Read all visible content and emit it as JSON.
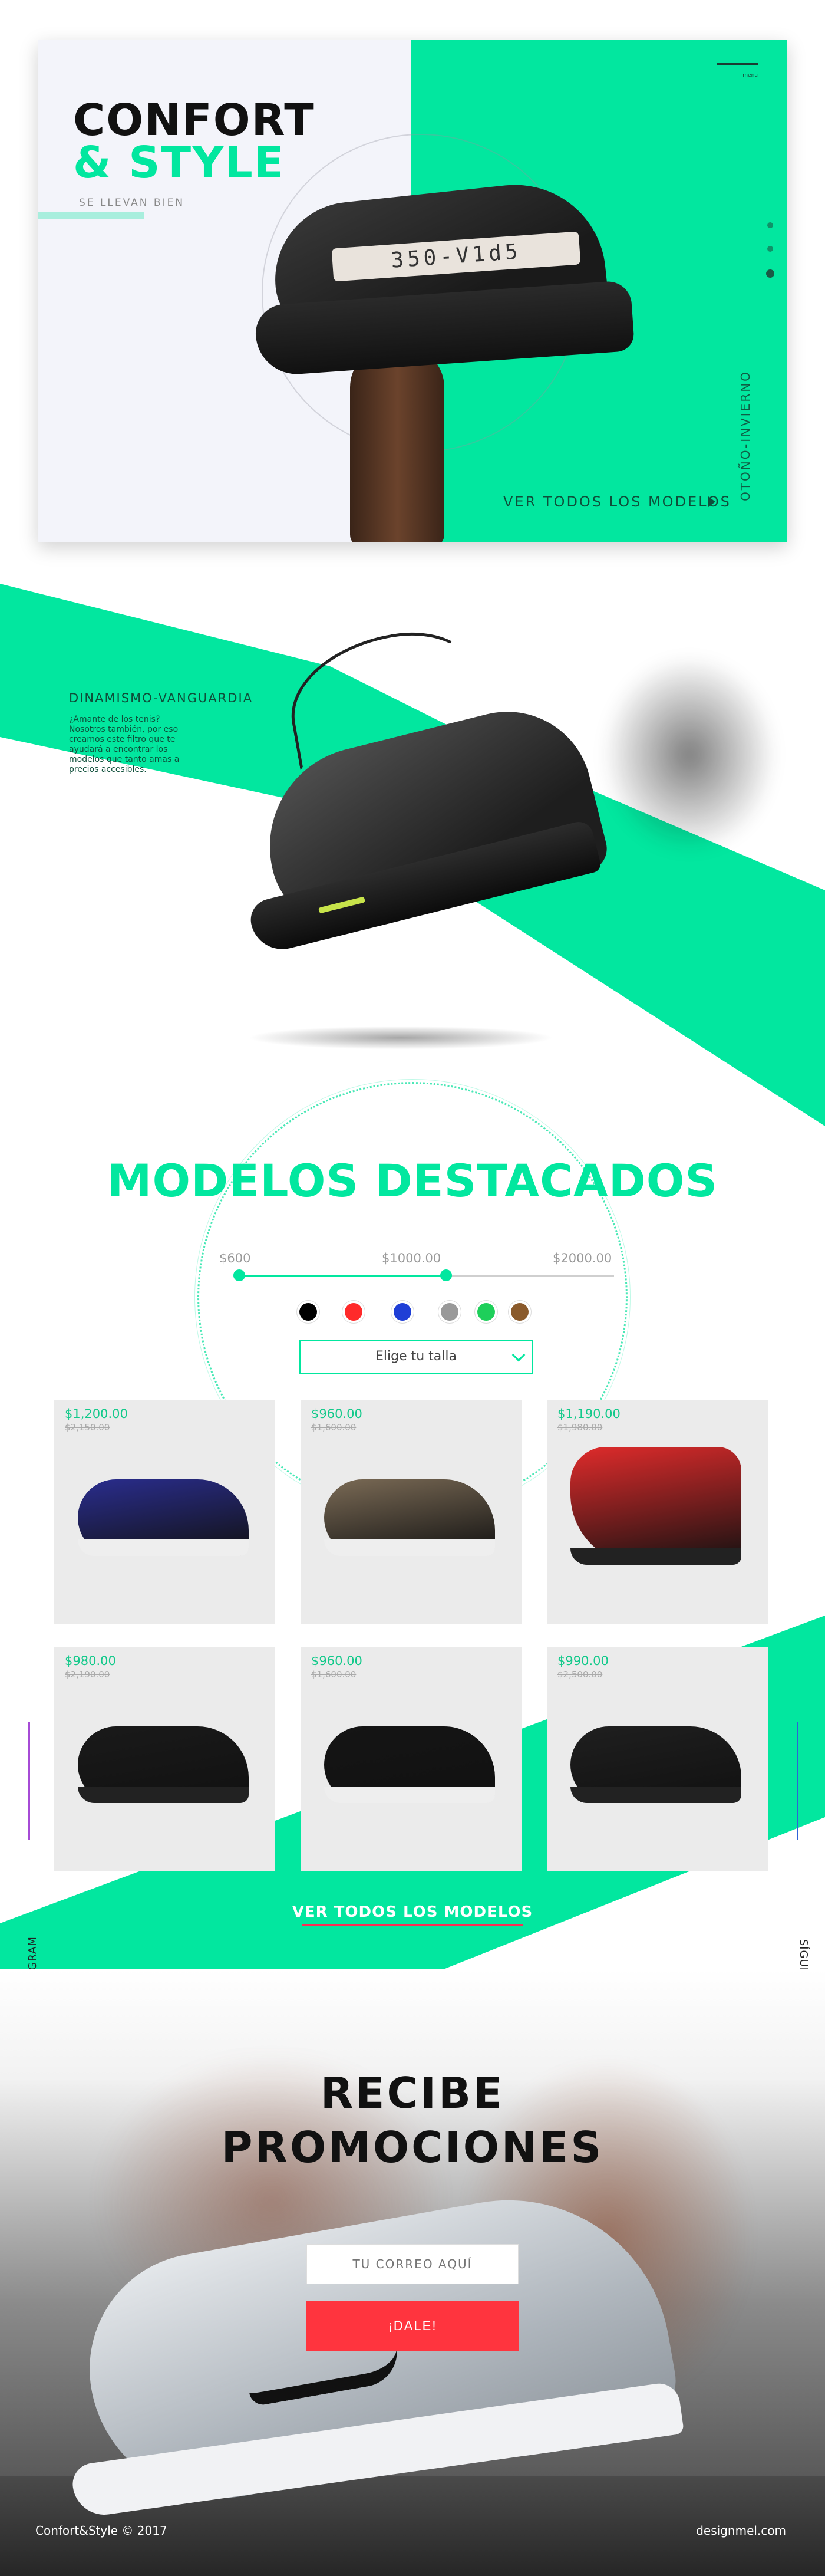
{
  "hero": {
    "title_line1": "CONFORT",
    "title_line2": "& STYLE",
    "subtitle": "SE LLEVAN BIEN",
    "band_text": "350-V1d5",
    "cta": "VER TODOS LOS MODELOS",
    "season": "OTOÑO-INVIERNO",
    "menu_text": "menu",
    "accent_color": "#02e79f"
  },
  "section2": {
    "title": "DINAMISMO-VANGUARDIA",
    "text": "¿Amante de los tenis? Nosotros también, por eso creamos este filtro que te ayudará a encontrar los modelos que tanto amas a precios accesibles."
  },
  "featured": {
    "title": "MODELOS DESTACADOS",
    "price_min": "$600",
    "price_mid": "$1000.00",
    "price_max": "$2000.00",
    "size_placeholder": "Elige tu talla",
    "colors": [
      "#000000",
      "#ff2a2a",
      "#1f3fd6",
      "#999999",
      "#1ecf5a",
      "#8a5a2b"
    ]
  },
  "products": [
    {
      "price": "$1,200.00",
      "old_price": "$2,150.00",
      "shoe_color": "#2a2d8e"
    },
    {
      "price": "$960.00",
      "old_price": "$1,600.00",
      "shoe_color": "#7a6a55"
    },
    {
      "price": "$1,190.00",
      "old_price": "$1,980.00",
      "shoe_color": "#e02b2b"
    },
    {
      "price": "$980.00",
      "old_price": "$2,190.00",
      "shoe_color": "#1a1a1a"
    },
    {
      "price": "$960.00",
      "old_price": "$1,600.00",
      "shoe_color": "#151515"
    },
    {
      "price": "$990.00",
      "old_price": "$2,500.00",
      "shoe_color": "#1f1f1f"
    }
  ],
  "view_all": "VER TODOS LOS MODELOS",
  "social": {
    "instagram": "SÍGUENOS EN INSTAGRAM",
    "facebook": "SÍGUENOS EN FACEBOOK"
  },
  "promo": {
    "title_line1": "RECIBE",
    "title_line2": "PROMOCIONES",
    "email_placeholder": "TU CORREO AQUÍ",
    "button": "¡DALE!"
  },
  "footer": {
    "left": "Confort&Style © 2017",
    "right": "designmel.com"
  }
}
